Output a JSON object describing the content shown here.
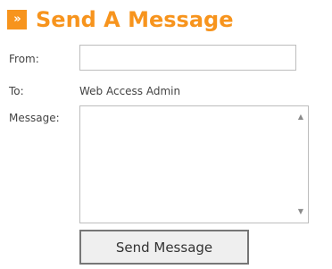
{
  "header": {
    "icon": "double-chevron-right-icon",
    "icon_glyph": "»",
    "title": "Send A Message",
    "accent_color": "#f7941d"
  },
  "form": {
    "from_label": "From:",
    "from_value": "",
    "to_label": "To:",
    "to_value": "Web Access Admin",
    "message_label": "Message:",
    "message_value": "",
    "submit_label": "Send Message"
  },
  "scrollbar": {
    "up_icon": "scroll-up-arrow-icon",
    "up_glyph": "▲",
    "down_icon": "scroll-down-arrow-icon",
    "down_glyph": "▼"
  }
}
